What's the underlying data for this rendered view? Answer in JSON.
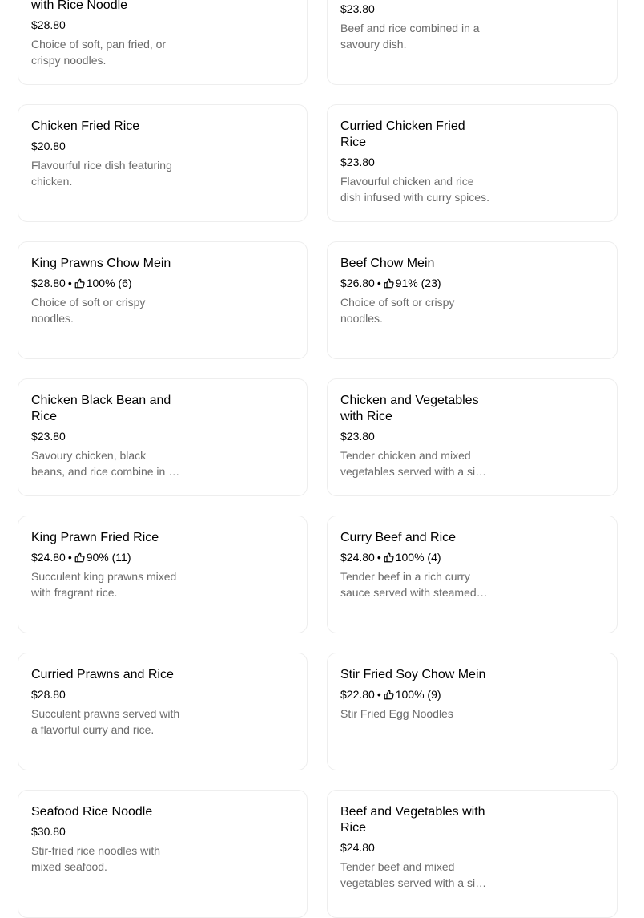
{
  "menu": {
    "items": [
      {
        "name": "with Rice Noodle",
        "price": "$28.80",
        "rating": null,
        "description": "Choice of soft, pan fried, or crispy noodles."
      },
      {
        "name": "",
        "price": "$23.80",
        "rating": null,
        "description": "Beef and rice combined in a savoury dish."
      },
      {
        "name": "Chicken Fried Rice",
        "price": "$20.80",
        "rating": null,
        "description": "Flavourful rice dish featuring chicken."
      },
      {
        "name": "Curried Chicken Fried Rice",
        "price": "$23.80",
        "rating": null,
        "description": "Flavourful chicken and rice dish infused with curry spices."
      },
      {
        "name": "King Prawns Chow Mein",
        "price": "$28.80",
        "rating": "100% (6)",
        "description": "Choice of soft or crispy noodles."
      },
      {
        "name": "Beef Chow Mein",
        "price": "$26.80",
        "rating": "91% (23)",
        "description": "Choice of soft or crispy noodles."
      },
      {
        "name": "Chicken Black Bean and Rice",
        "price": "$23.80",
        "rating": null,
        "description": "Savoury chicken, black beans, and rice combine in a hearty dish."
      },
      {
        "name": "Chicken and Vegetables with Rice",
        "price": "$23.80",
        "rating": null,
        "description": "Tender chicken and mixed vegetables served with a side of rice."
      },
      {
        "name": "King Prawn Fried Rice",
        "price": "$24.80",
        "rating": "90% (11)",
        "description": "Succulent king prawns mixed with fragrant rice."
      },
      {
        "name": "Curry Beef and Rice",
        "price": "$24.80",
        "rating": "100% (4)",
        "description": "Tender beef in a rich curry sauce served with steamed rice."
      },
      {
        "name": "Curried Prawns and Rice",
        "price": "$28.80",
        "rating": null,
        "description": "Succulent prawns served with a flavorful curry and rice."
      },
      {
        "name": "Stir Fried Soy Chow Mein",
        "price": "$22.80",
        "rating": "100% (9)",
        "description": "Stir Fried Egg Noodles"
      },
      {
        "name": "Seafood Rice Noodle",
        "price": "$30.80",
        "rating": null,
        "description": "Stir-fried rice noodles with mixed seafood."
      },
      {
        "name": "Beef and Vegetables with Rice",
        "price": "$24.80",
        "rating": null,
        "description": "Tender beef and mixed vegetables served with a side of rice."
      }
    ]
  },
  "ui": {
    "separator": "•",
    "thumb_icon": "thumbs-up-icon",
    "card_border_color": "#eeeeee",
    "description_color": "#6b6b6b"
  }
}
